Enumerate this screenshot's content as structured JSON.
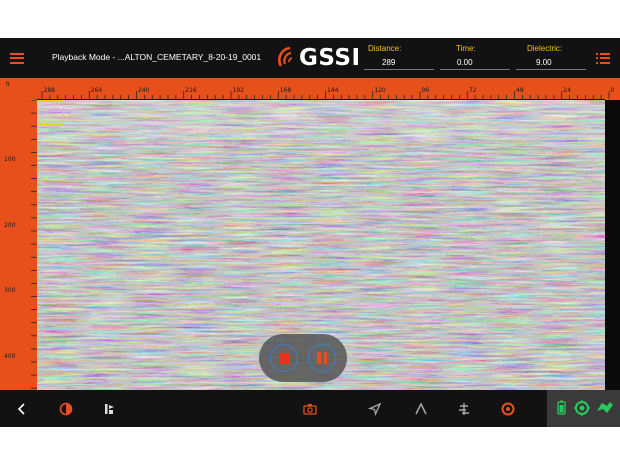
{
  "header": {
    "mode_label": "Playback Mode - ...ALTON_CEMETARY_8-20-19_0001",
    "logo_text": "GSSI",
    "distance": {
      "label": "Distance:",
      "value": "289"
    },
    "time": {
      "label": "Time:",
      "value": "0.00"
    },
    "dielectric": {
      "label": "Dielectric:",
      "value": "9.00"
    }
  },
  "top_ruler": {
    "unit": "ft",
    "labels": [
      "288",
      "264",
      "240",
      "216",
      "192",
      "168",
      "144",
      "120",
      "96",
      "72",
      "48",
      "24",
      "0"
    ]
  },
  "left_ruler": {
    "labels": [
      "100",
      "200",
      "300",
      "400"
    ]
  },
  "controls": {
    "stop": "stop",
    "pause": "pause"
  },
  "toolbar": {
    "items": [
      "back-icon",
      "contrast-icon",
      "flag-marker-icon",
      "camera-icon",
      "gps-arrow-icon",
      "peak-icon",
      "filter-icon",
      "target-icon",
      "battery-icon",
      "gps-status-icon",
      "link-status-icon"
    ]
  },
  "colors": {
    "accent": "#e8501b",
    "label": "#f2c41c",
    "bar": "#121212",
    "control_ring": "#3d7fd1",
    "status_green": "#28c95a"
  }
}
